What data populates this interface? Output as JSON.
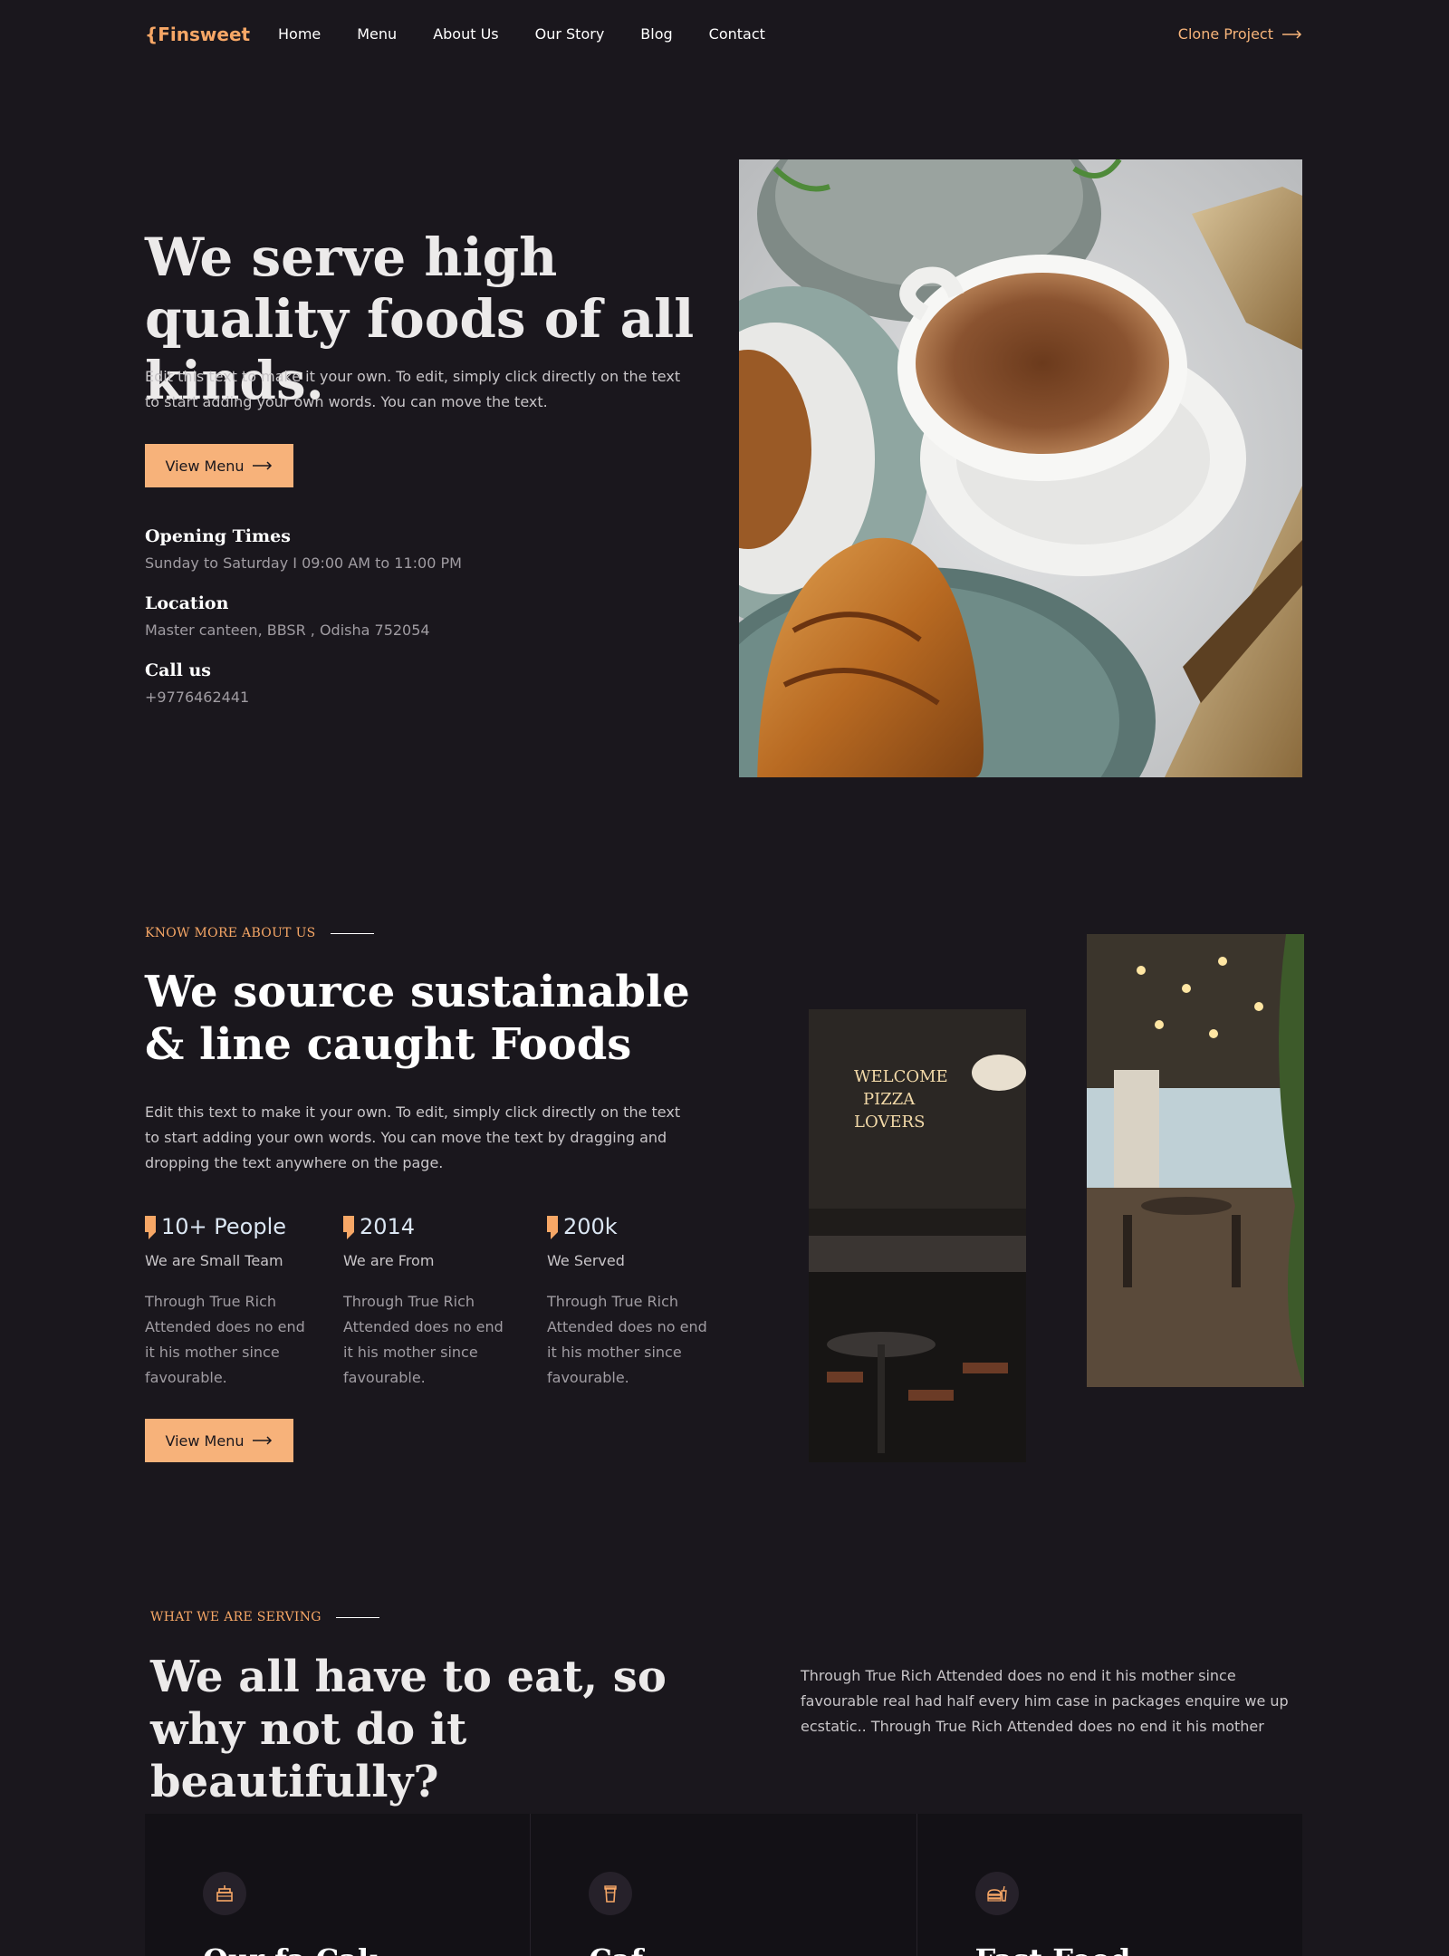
{
  "nav": {
    "logo": "{Finsweet",
    "links": [
      "Home",
      "Menu",
      "About Us",
      "Our Story",
      "Blog",
      "Contact"
    ],
    "cta": "Clone Project"
  },
  "hero": {
    "title": "We serve high quality foods of all kinds.",
    "description": "Edit this text to make it your own. To edit, simply click directly on the text to start adding your own words. You can move the text.",
    "button": "View Menu",
    "info": [
      {
        "title": "Opening Times",
        "text": "Sunday to Saturday  I  09:00 AM to 11:00 PM"
      },
      {
        "title": "Location",
        "text": "Master canteen, BBSR , Odisha 752054"
      },
      {
        "title": "Call us",
        "text": "+9776462441"
      }
    ]
  },
  "about": {
    "eyebrow": "KNOW MORE ABOUT US",
    "title": "We source sustainable & line caught Foods",
    "description": "Edit this text to make it your own. To edit, simply click directly on the text to start adding your own words. You can move the text by dragging and dropping the text anywhere on the page.",
    "stats": [
      {
        "value": "10+ People",
        "label": "We are Small Team",
        "body": "Through True Rich Attended does no end it his mother since favourable."
      },
      {
        "value": "2014",
        "label": "We are From",
        "body": "Through True Rich Attended does no end it his mother since favourable."
      },
      {
        "value": "200k",
        "label": "We Served",
        "body": "Through True Rich Attended does no end it his mother since favourable."
      }
    ],
    "button": "View Menu"
  },
  "serving": {
    "eyebrow": "WHAT WE ARE SERVING",
    "title": "We all have to eat, so why not do it beautifully?",
    "description": "Through True Rich Attended does no end it his mother since favourable real had half every him case in packages enquire we up ecstatic.. Through True Rich Attended does no end it his mother",
    "cards": [
      {
        "icon": "cake-icon",
        "title": "Our fa Cak"
      },
      {
        "icon": "cup-icon",
        "title": "Caf"
      },
      {
        "icon": "fast-food-icon",
        "title": "Fast Food"
      }
    ]
  },
  "colors": {
    "background": "#1a171d",
    "accent": "#f7b27a",
    "logo": "#f7a766"
  }
}
